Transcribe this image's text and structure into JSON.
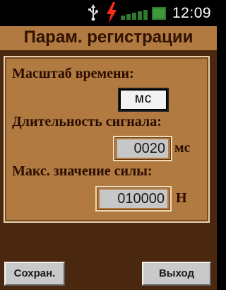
{
  "status_bar": {
    "time": "12:09",
    "icons": [
      "usb-icon",
      "charging-bolt-icon",
      "signal-icon",
      "battery-icon"
    ],
    "colors": {
      "bolt": "#ff2a1a",
      "signal": "#2f7a2f",
      "battery": "#2f7a2f"
    }
  },
  "title": "Парам. регистрации",
  "form": {
    "time_scale": {
      "label": "Масштаб времени:",
      "value": "мс"
    },
    "signal_duration": {
      "label": "Длительность сигнала:",
      "value": "0020",
      "unit": "мс"
    },
    "max_force": {
      "label": "Макс. значение силы:",
      "value": "010000",
      "unit": "Н"
    }
  },
  "buttons": {
    "save": "Сохран.",
    "exit": "Выход"
  },
  "colors": {
    "background": "#4a2810",
    "panel": "#b07a40",
    "text": "#2a0c00"
  }
}
